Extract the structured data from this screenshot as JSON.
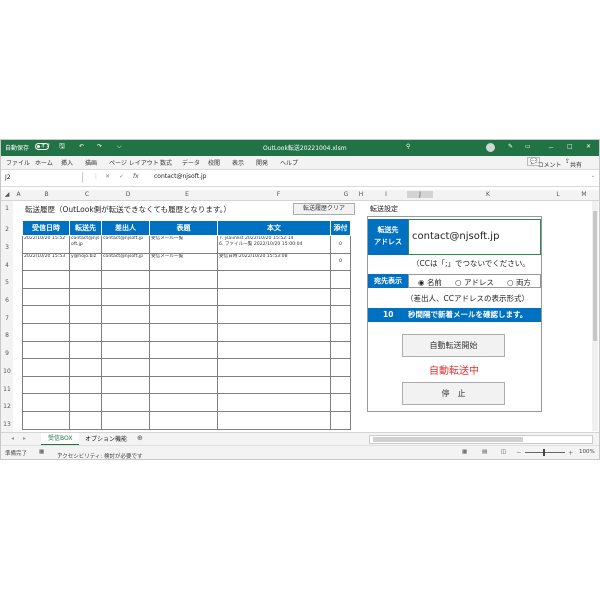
{
  "titlebar": {
    "autosave_label": "自動保存",
    "autosave_state": "オフ",
    "doc_title": "OutLook転送20221004.xlsm",
    "search_icon": "search-icon",
    "minimize": "－",
    "maximize": "□",
    "close": "✕"
  },
  "menu": {
    "items": [
      "ファイル",
      "ホーム",
      "挿入",
      "描画",
      "ページ レイアウト",
      "数式",
      "データ",
      "校閲",
      "表示",
      "開発",
      "ヘルプ"
    ],
    "comment_label": "コメント",
    "share_label": "共有"
  },
  "formula_bar": {
    "cell_ref": "J2",
    "fx_label": "fx",
    "value": "contact@njsoft.jp"
  },
  "columns": [
    "A",
    "B",
    "C",
    "D",
    "E",
    "F",
    "G",
    "H",
    "I",
    "J",
    "K",
    "L",
    "M"
  ],
  "rows": [
    "1",
    "2",
    "3",
    "4",
    "5",
    "6",
    "7",
    "8",
    "9",
    "10",
    "11",
    "12",
    "13"
  ],
  "history": {
    "heading": "転送履歴（OutLook側が転送できなくても履歴となります。）",
    "clear_button": "転送履歴クリア",
    "headers": [
      "受信日時",
      "転送先",
      "差出人",
      "表題",
      "本文",
      "添付"
    ],
    "rows": [
      {
        "date": "2022/10/20 15:52",
        "to": "contact@njsoft.jp",
        "from": "contact@njsoft.jp",
        "subject": "受信メール一覧",
        "body1": "7. jsaiinlist 2022/10/20 15:52:14",
        "body2": "6. ファイル一覧 2022/10/20 15:00:04",
        "attach": "0"
      },
      {
        "date": "2022/10/20 15:53",
        "to": "y@hojo.biz",
        "from": "contact@njsoft.jp",
        "subject": "受信メール一覧",
        "body1": "受信日時:2022/10/20 15:53:08",
        "body2": "",
        "attach": "0"
      }
    ]
  },
  "settings": {
    "heading": "転送設定",
    "address_label_1": "転送先",
    "address_label_2": "アドレス",
    "address_value": "contact@njsoft.jp",
    "cc_note": "（CCは「;」でつないでください。",
    "display_label": "宛先表示",
    "options": [
      "名前",
      "アドレス",
      "両方"
    ],
    "display_note": "（差出人、CCアドレスの表示形式）",
    "interval_value": "10",
    "interval_text": "秒間隔で新着メールを確認します。",
    "start_button": "自動転送開始",
    "status": "自動転送中",
    "stop_button": "停　止",
    "status_color": "#e03030"
  },
  "sheet_tabs": {
    "tabs": [
      "受信BOX",
      "オプション機能"
    ],
    "add": "⊕"
  },
  "statusbar": {
    "ready": "準備完了",
    "accessibility": "アクセシビリティ: 検討が必要です",
    "zoom": "100%"
  }
}
